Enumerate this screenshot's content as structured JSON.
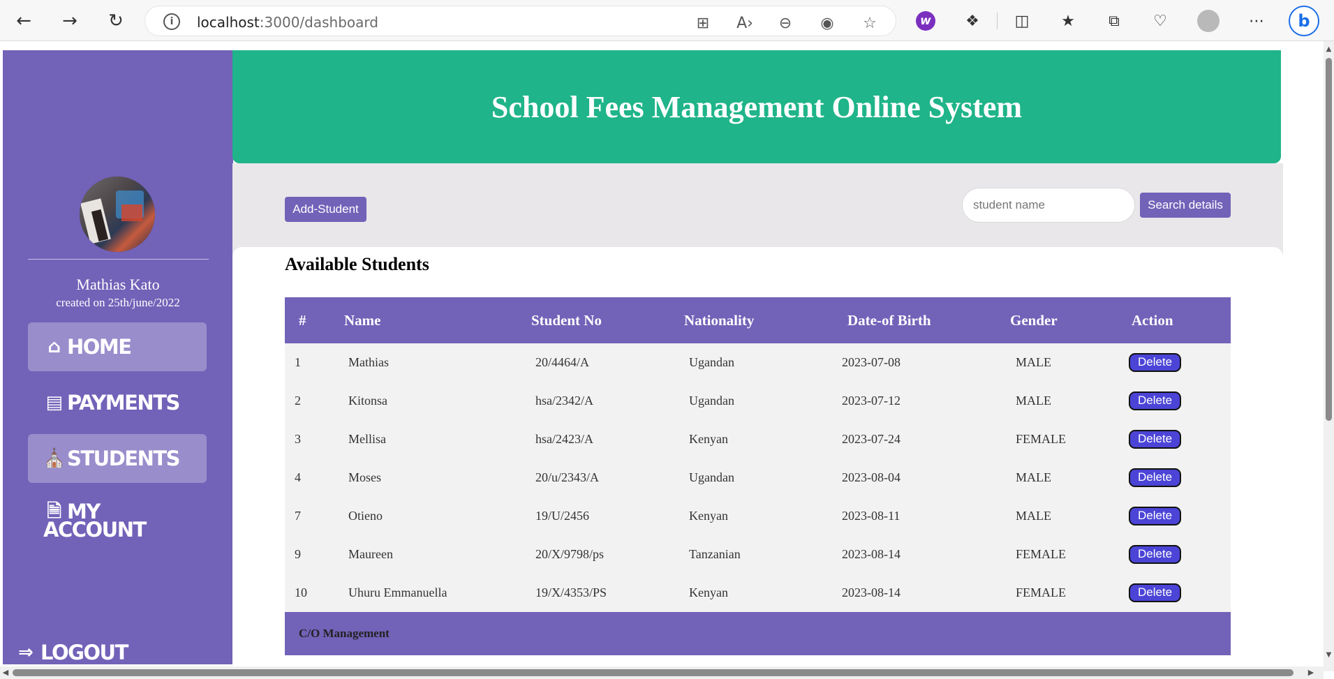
{
  "browser": {
    "url_host": "localhost",
    "url_path": ":3000/dashboard",
    "icons": [
      "back-icon",
      "forward-icon",
      "refresh-icon",
      "site-info-icon",
      "apps-icon",
      "read-aloud-icon",
      "zoom-out-icon",
      "tracking-icon",
      "favorite-star-icon",
      "extension-w-icon",
      "extensions-icon",
      "split-screen-icon",
      "favorites-icon",
      "collections-icon",
      "performance-icon",
      "profile-icon",
      "more-icon",
      "bing-copilot-icon"
    ]
  },
  "sidebar": {
    "user_name": "Mathias Kato",
    "created": "created on 25th/june/2022",
    "menu": [
      {
        "label": "HOME",
        "icon": "home-icon",
        "active": true
      },
      {
        "label": "PAYMENTS",
        "icon": "money-icon",
        "active": false
      },
      {
        "label": "STUDENTS",
        "icon": "school-icon",
        "active": true
      },
      {
        "label_line1": "MY",
        "label_line2": "ACCOUNT",
        "icon": "invoice-icon",
        "active": false
      }
    ],
    "logout": "LOGOUT"
  },
  "header": {
    "title": "School Fees Management Online System"
  },
  "toolbar": {
    "add_student": "Add-Student",
    "search_placeholder": "student name",
    "search_button": "Search details"
  },
  "students": {
    "heading": "Available Students",
    "columns": [
      "#",
      "Name",
      "Student No",
      "Nationality",
      "Date-of Birth",
      "Gender",
      "Action"
    ],
    "rows": [
      {
        "id": "1",
        "name": "Mathias",
        "student_no": "20/4464/A",
        "nationality": "Ugandan",
        "dob": "2023-07-08",
        "gender": "MALE",
        "action": "Delete"
      },
      {
        "id": "2",
        "name": "Kitonsa",
        "student_no": "hsa/2342/A",
        "nationality": "Ugandan",
        "dob": "2023-07-12",
        "gender": "MALE",
        "action": "Delete"
      },
      {
        "id": "3",
        "name": "Mellisa",
        "student_no": "hsa/2423/A",
        "nationality": "Kenyan",
        "dob": "2023-07-24",
        "gender": "FEMALE",
        "action": "Delete"
      },
      {
        "id": "4",
        "name": "Moses",
        "student_no": "20/u/2343/A",
        "nationality": "Ugandan",
        "dob": "2023-08-04",
        "gender": "MALE",
        "action": "Delete"
      },
      {
        "id": "7",
        "name": "Otieno",
        "student_no": "19/U/2456",
        "nationality": "Kenyan",
        "dob": "2023-08-11",
        "gender": "MALE",
        "action": "Delete"
      },
      {
        "id": "9",
        "name": "Maureen",
        "student_no": "20/X/9798/ps",
        "nationality": "Tanzanian",
        "dob": "2023-08-14",
        "gender": "FEMALE",
        "action": "Delete"
      },
      {
        "id": "10",
        "name": "Uhuru Emmanuella",
        "student_no": "19/X/4353/PS",
        "nationality": "Kenyan",
        "dob": "2023-08-14",
        "gender": "FEMALE",
        "action": "Delete"
      }
    ],
    "footer": "C/O Management"
  },
  "colors": {
    "sidebar": "#7262b8",
    "header": "#1fb489",
    "toolbar_bg": "#e9e7ea",
    "delete_button": "#4b44d6"
  }
}
